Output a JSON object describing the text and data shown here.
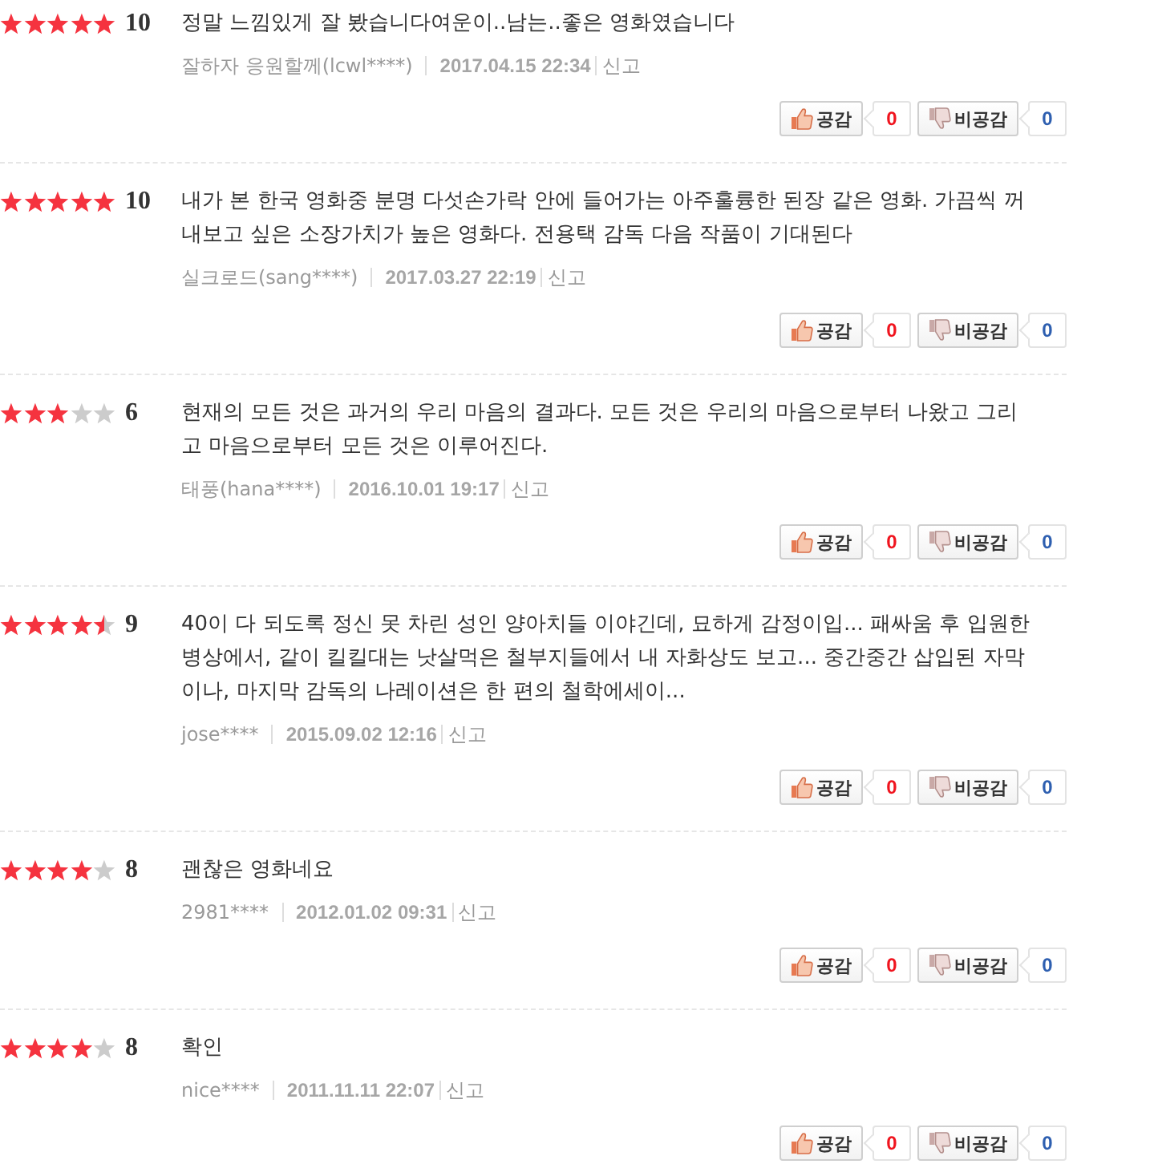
{
  "reviews": [
    {
      "stars": 5,
      "score": "10",
      "text": "정말 느낌있게 잘 봤습니다여운이..남는..좋은 영화였습니다",
      "author": "잘하자 응원할께(lcwl****)",
      "date": "2017.04.15 22:34",
      "report": "신고",
      "buttons": [
        {
          "kind": "like",
          "label": "공감",
          "count": "0"
        },
        {
          "kind": "dislike",
          "label": "비공감",
          "count": "0"
        }
      ]
    },
    {
      "stars": 5,
      "score": "10",
      "text": "내가 본 한국 영화중 분명 다섯손가락 안에 들어가는 아주훌륭한 된장 같은 영화. 가끔씩 꺼내보고 싶은 소장가치가 높은 영화다. 전용택 감독 다음 작품이 기대된다",
      "author": "실크로드(sang****)",
      "date": "2017.03.27 22:19",
      "report": "신고",
      "buttons": [
        {
          "kind": "like",
          "label": "공감",
          "count": "0"
        },
        {
          "kind": "dislike",
          "label": "비공감",
          "count": "0"
        }
      ]
    },
    {
      "stars": 3,
      "score": "6",
      "text": "현재의 모든 것은 과거의 우리 마음의 결과다. 모든 것은 우리의 마음으로부터 나왔고 그리고 마음으로부터 모든 것은 이루어진다.",
      "author": "태풍(hana****)",
      "date": "2016.10.01 19:17",
      "report": "신고",
      "buttons": [
        {
          "kind": "like",
          "label": "공감",
          "count": "0"
        },
        {
          "kind": "dislike",
          "label": "비공감",
          "count": "0"
        }
      ]
    },
    {
      "stars": 4.5,
      "score": "9",
      "text": "40이 다 되도록 정신 못 차린 성인 양아치들 이야긴데, 묘하게 감정이입... 패싸움 후 입원한 병상에서, 같이 킬킬대는 낫살먹은 철부지들에서 내 자화상도 보고... 중간중간 삽입된 자막이나, 마지막 감독의 나레이션은 한 편의 철학에세이...",
      "author": "jose****",
      "date": "2015.09.02 12:16",
      "report": "신고",
      "buttons": [
        {
          "kind": "like",
          "label": "공감",
          "count": "0"
        },
        {
          "kind": "dislike",
          "label": "비공감",
          "count": "0"
        }
      ]
    },
    {
      "stars": 4,
      "score": "8",
      "text": "괜찮은 영화네요",
      "author": "2981****",
      "date": "2012.01.02 09:31",
      "report": "신고",
      "buttons": [
        {
          "kind": "like",
          "label": "공감",
          "count": "0"
        },
        {
          "kind": "dislike",
          "label": "비공감",
          "count": "0"
        }
      ]
    },
    {
      "stars": 4,
      "score": "8",
      "text": "확인",
      "author": "nice****",
      "date": "2011.11.11 22:07",
      "report": "신고",
      "buttons": [
        {
          "kind": "like",
          "label": "공감",
          "count": "0"
        },
        {
          "kind": "dislike",
          "label": "비공감",
          "count": "0"
        }
      ]
    }
  ]
}
